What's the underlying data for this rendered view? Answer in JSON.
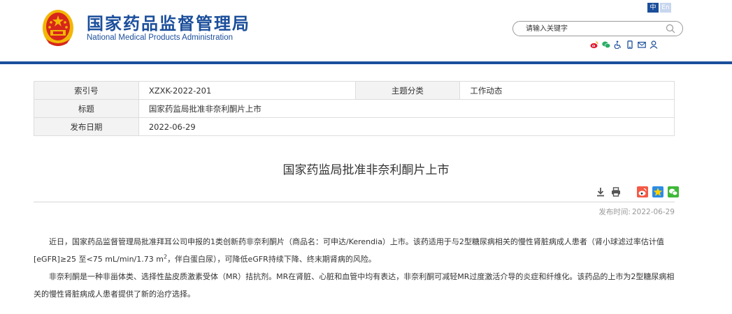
{
  "header": {
    "title": "国家药品监督管理局",
    "subtitle": "National Medical Products Administration",
    "lang_zh": "中",
    "lang_en": "En",
    "search_placeholder": "请输入关键字",
    "social_icons": [
      "weibo-icon",
      "wechat-icon",
      "accessibility-icon",
      "mobile-icon",
      "mail-icon",
      "user-icon"
    ],
    "colors": {
      "brand": "#1b4e9b",
      "emblem_red": "#d7261b",
      "emblem_gold": "#f2b705"
    }
  },
  "meta": {
    "index_label": "索引号",
    "index_value": "XZXK-2022-201",
    "category_label": "主题分类",
    "category_value": "工作动态",
    "title_label": "标题",
    "title_value": "国家药监局批准非奈利酮片上市",
    "date_label": "发布日期",
    "date_value": "2022-06-29"
  },
  "article": {
    "title": "国家药监局批准非奈利酮片上市",
    "tools": [
      "download-icon",
      "print-icon",
      "weibo-share-icon",
      "qzone-share-icon",
      "wechat-share-icon"
    ],
    "pub_time_label": "发布时间:",
    "pub_time_value": "2022-06-29",
    "p1_part1": "近日，国家药品监督管理局批准拜耳公司申报的1类创新药非奈利酮片（商品名：可申达/Kerendia）上市。该药适用于与2型糖尿病相关的慢性肾脏病成人患者（肾小球滤过率估计值[eGFR]≥25 至<75 mL/min/1.73 m",
    "p1_sup": "2",
    "p1_part2": "，伴白蛋白尿），可降低eGFR持续下降、终末期肾病的风险。",
    "p2": "非奈利酮是一种非甾体类、选择性盐皮质激素受体（MR）拮抗剂。MR在肾脏、心脏和血管中均有表达，非奈利酮可减轻MR过度激活介导的炎症和纤维化。该药品的上市为2型糖尿病相关的慢性肾脏病成人患者提供了新的治疗选择。"
  }
}
